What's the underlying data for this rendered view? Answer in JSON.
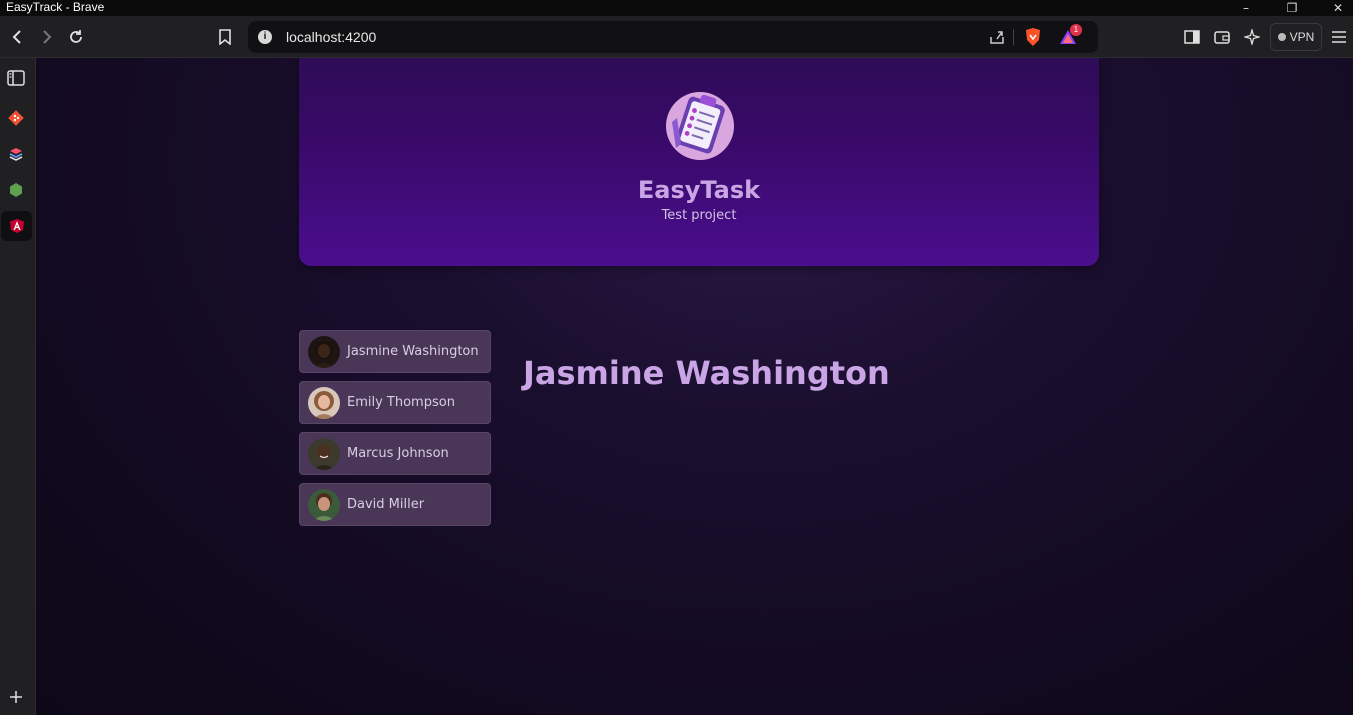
{
  "window": {
    "title": "EasyTrack - Brave"
  },
  "browser": {
    "url": "localhost:4200",
    "vpn_label": "VPN",
    "rewards_badge": "1"
  },
  "app": {
    "title": "EasyTask",
    "subtitle": "Test project"
  },
  "users": [
    {
      "name": "Jasmine Washington",
      "skin": "#3b2518",
      "hair": "#1a120c"
    },
    {
      "name": "Emily Thompson",
      "skin": "#e6b8a0",
      "hair": "#8a5a3a"
    },
    {
      "name": "Marcus Johnson",
      "skin": "#4a3020",
      "hair": "#1a120c"
    },
    {
      "name": "David Miller",
      "skin": "#c8957a",
      "hair": "#4a2e1a"
    }
  ],
  "selected_user": {
    "name": "Jasmine Washington"
  },
  "colors": {
    "accent": "#c9a5e6",
    "header_gradient_top": "#2c0c55",
    "header_gradient_bottom": "#4a0e8e",
    "user_button_bg": "#4a3657"
  }
}
